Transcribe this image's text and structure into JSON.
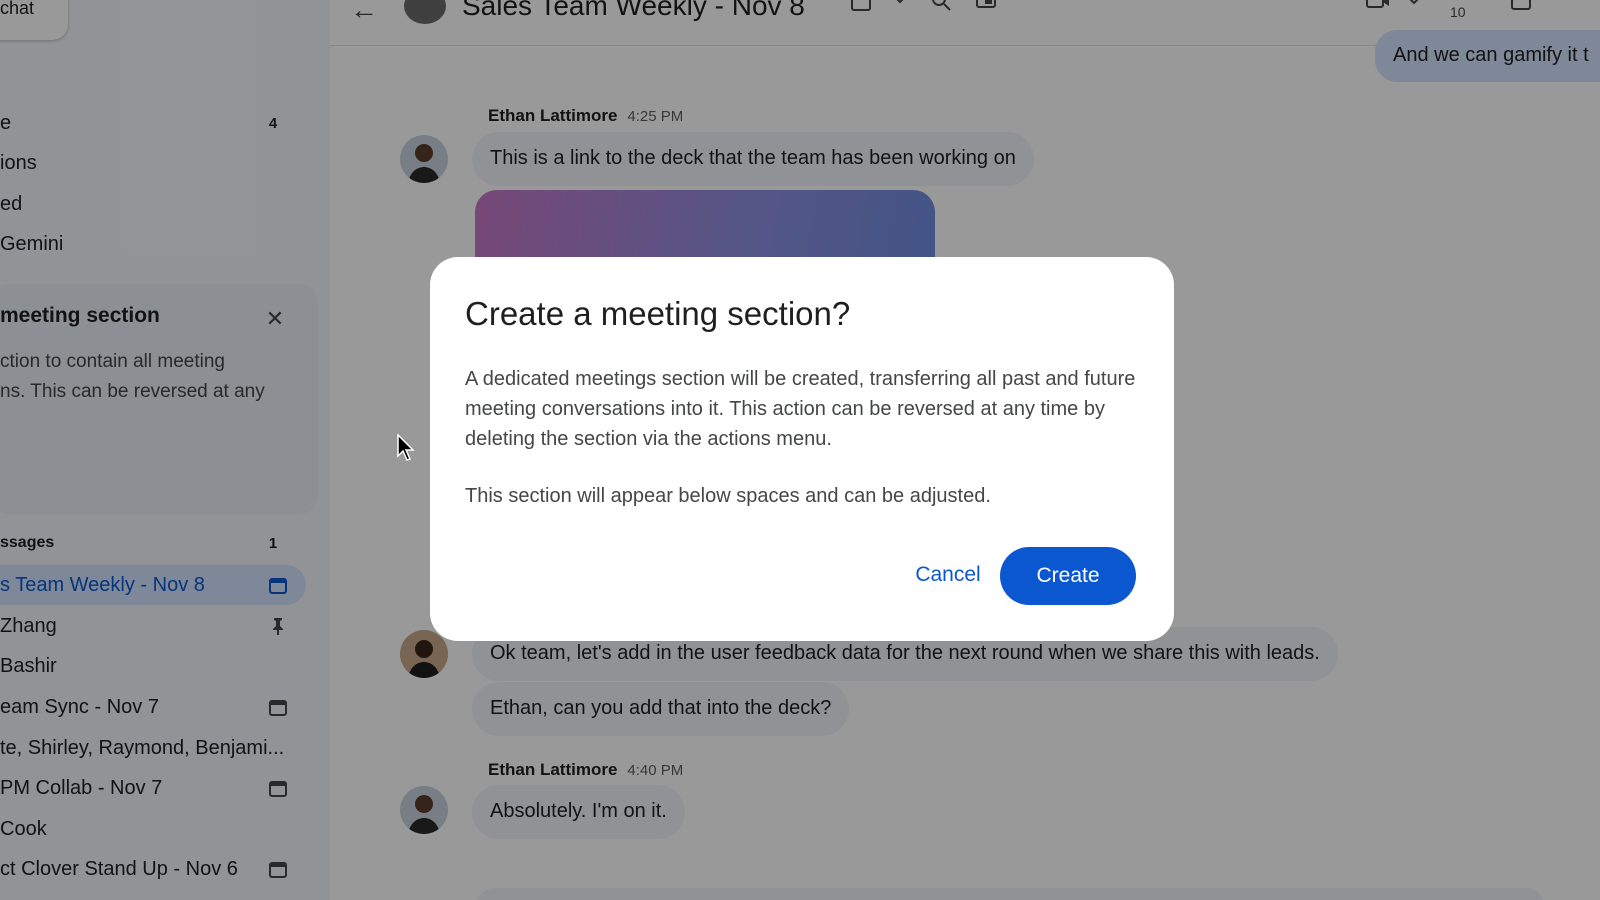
{
  "sidebar": {
    "new_chat_label": "chat",
    "nav": [
      {
        "label": "e",
        "count": "4"
      },
      {
        "label": "ions",
        "count": ""
      },
      {
        "label": "ed",
        "count": ""
      },
      {
        "label": "Gemini",
        "count": ""
      }
    ],
    "promo": {
      "title": "meeting section",
      "close_glyph": "✕",
      "line1": "ction to contain all meeting",
      "line2": "ns. This can be reversed at any"
    },
    "section": {
      "label": "ssages",
      "count": "1"
    },
    "dms": [
      {
        "label": "s Team Weekly - Nov 8",
        "icon": "calendar-icon"
      },
      {
        "label": "Zhang",
        "icon": "pin-icon"
      },
      {
        "label": "Bashir",
        "icon": ""
      },
      {
        "label": "eam Sync - Nov 7",
        "icon": "calendar-icon"
      },
      {
        "label": "te, Shirley, Raymond, Benjami...",
        "icon": ""
      },
      {
        "label": " PM Collab - Nov 7",
        "icon": "calendar-icon"
      },
      {
        "label": "Cook",
        "icon": ""
      },
      {
        "label": "ct Clover Stand Up - Nov 6",
        "icon": "calendar-icon"
      }
    ]
  },
  "header": {
    "back_glyph": "←",
    "title": "Sales Team Weekly - Nov 8",
    "participants_count": "10"
  },
  "messages": [
    {
      "name": "Ethan Lattimore",
      "time": "4:25 PM",
      "text": "This is a link to the deck that the team has been working on"
    },
    {
      "name": "",
      "time": "",
      "text": "Ok team, let's add in the user feedback data for the next round when we share this with leads."
    },
    {
      "name": "",
      "time": "",
      "text": "Ethan, can you add that into the deck?"
    },
    {
      "name": "Ethan Lattimore",
      "time": "4:40 PM",
      "text": "Absolutely. I'm on it."
    }
  ],
  "top_right_message": "And we can gamify it t",
  "dialog": {
    "title": "Create a meeting section?",
    "body": "A dedicated meetings section will be created, transferring all past and future meeting conversations into it. This action can be reversed at any time by deleting the section via the actions menu.",
    "body2": "This section will appear below spaces and can be adjusted.",
    "cancel_label": "Cancel",
    "create_label": "Create"
  },
  "colors": {
    "accent": "#0b57d0",
    "active_row_bg": "#d3e3fd",
    "sidebar_bg": "#f3f6fc",
    "bubble_bg": "#f0f4f9"
  }
}
